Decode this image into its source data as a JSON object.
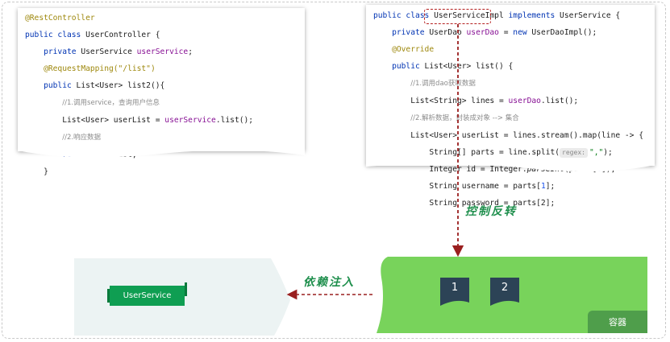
{
  "left_code": {
    "line1": "@RestController",
    "line2_kw": "public class",
    "line2_rest": " UserController {",
    "line3_kw": "private",
    "line3_type": " UserService ",
    "line3_field": "userService",
    "line3_end": ";",
    "line4": "@RequestMapping(\"/list\")",
    "line5_kw": "public",
    "line5_rest": " List<User> list2(){",
    "line6": "//1.调用service，查询用户信息",
    "line7_a": "List<User> userList = ",
    "line7_field": "userService",
    "line7_b": ".list();",
    "line8": "//2.响应数据",
    "line9_kw": "return",
    "line9_rest": " userList;",
    "line10": "}"
  },
  "right_code": {
    "line1_kw": "public class",
    "line1_name": " UserServiceImpl ",
    "line1_kw2": "implements",
    "line1_rest": " UserService {",
    "line2_kw": "private",
    "line2_a": " UserDao ",
    "line2_field": "userDao",
    "line2_b": " = ",
    "line2_kw2": "new",
    "line2_c": " UserDaoImpl();",
    "line3": "@Override",
    "line4_kw": "public",
    "line4_rest": " List<User> list() {",
    "line5": "//1.调用dao获取数据",
    "line6_a": "List<String> lines = ",
    "line6_field": "userDao",
    "line6_b": ".list();",
    "line7": "//2.解析数据，封装成对象 --> 集合",
    "line8": "List<User> userList = lines.stream().map(line -> {",
    "line9_a": "String[] parts = line.split(",
    "line9_hint": "regex:",
    "line9_str": "\",\"",
    "line9_b": ");",
    "line10_a": "Integer id = Integer.",
    "line10_italic": "parseInt",
    "line10_b": "(parts[",
    "line10_num": "0",
    "line10_c": "]);",
    "line11_a": "String username = parts[",
    "line11_num": "1",
    "line11_b": "];",
    "line12": "String password = parts[2];"
  },
  "labels": {
    "control_inversion": "控制反转",
    "dependency_injection": "依赖注入",
    "user_service": "UserService",
    "bean_1": "1",
    "bean_2": "2",
    "container": "容器"
  },
  "colors": {
    "accent_green": "#1f8f4d",
    "container_green": "#78d35b",
    "tab_green": "#4f9e4b",
    "service_green": "#0f9e52",
    "arrow_red": "#9a1f1f",
    "bean_navy": "#2c4356",
    "inject_panel": "#ecf3f3"
  }
}
